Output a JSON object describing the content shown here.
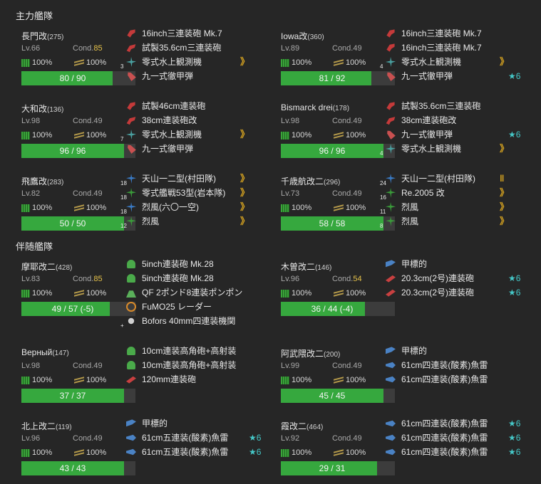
{
  "sections": {
    "main_fleet": "主力艦隊",
    "escort_fleet": "伴随艦隊"
  },
  "ships": [
    {
      "name": "長門改",
      "id": "(275)",
      "lv": "Lv.66",
      "cond_label": "Cond.",
      "cond": "85",
      "cond_high": true,
      "fuel": "100%",
      "ammo": "100%",
      "hp_text": "80 / 90",
      "hp_frac": 0.889,
      "equips": [
        {
          "icon": "mainred",
          "name": "16inch三連装砲 Mk.7",
          "slot": "",
          "prof": "",
          "star": ""
        },
        {
          "icon": "mainred2",
          "name": "試製35.6cm三連装砲",
          "slot": "",
          "prof": "",
          "star": ""
        },
        {
          "icon": "seaplane",
          "name": "零式水上観測機",
          "slot": "3",
          "prof": "》",
          "star": ""
        },
        {
          "icon": "apshell",
          "name": "九一式徹甲弾",
          "slot": "",
          "prof": "",
          "star": ""
        }
      ]
    },
    {
      "name": "Iowa改",
      "id": "(360)",
      "lv": "Lv.89",
      "cond_label": "Cond.",
      "cond": "49",
      "cond_high": false,
      "fuel": "100%",
      "ammo": "100%",
      "hp_text": "81 / 92",
      "hp_frac": 0.88,
      "equips": [
        {
          "icon": "mainred",
          "name": "16inch三連装砲 Mk.7",
          "slot": "",
          "prof": "",
          "star": ""
        },
        {
          "icon": "mainred",
          "name": "16inch三連装砲 Mk.7",
          "slot": "",
          "prof": "",
          "star": ""
        },
        {
          "icon": "seaplane",
          "name": "零式水上観測機",
          "slot": "4",
          "prof": "》",
          "star": ""
        },
        {
          "icon": "apshell",
          "name": "九一式徹甲弾",
          "slot": "",
          "prof": "",
          "star": "★6"
        }
      ]
    },
    {
      "name": "大和改",
      "id": "(136)",
      "lv": "Lv.98",
      "cond_label": "Cond.",
      "cond": "49",
      "cond_high": false,
      "fuel": "100%",
      "ammo": "100%",
      "hp_text": "96 / 96",
      "hp_frac": 1.0,
      "equips": [
        {
          "icon": "mainred",
          "name": "試製46cm連装砲",
          "slot": "",
          "prof": "",
          "star": ""
        },
        {
          "icon": "mainred2",
          "name": "38cm連装砲改",
          "slot": "",
          "prof": "",
          "star": ""
        },
        {
          "icon": "seaplane",
          "name": "零式水上観測機",
          "slot": "7",
          "prof": "》",
          "star": ""
        },
        {
          "icon": "apshell",
          "name": "九一式徹甲弾",
          "slot": "",
          "prof": "",
          "star": ""
        }
      ]
    },
    {
      "name": "Bismarck drei",
      "id": "(178)",
      "lv": "Lv.98",
      "cond_label": "Cond.",
      "cond": "49",
      "cond_high": false,
      "fuel": "100%",
      "ammo": "100%",
      "hp_text": "96 / 96",
      "hp_frac": 1.0,
      "equips": [
        {
          "icon": "mainred",
          "name": "試製35.6cm三連装砲",
          "slot": "",
          "prof": "",
          "star": ""
        },
        {
          "icon": "mainred2",
          "name": "38cm連装砲改",
          "slot": "",
          "prof": "",
          "star": ""
        },
        {
          "icon": "apshell",
          "name": "九一式徹甲弾",
          "slot": "",
          "prof": "",
          "star": "★6"
        },
        {
          "icon": "seaplane",
          "name": "零式水上観測機",
          "slot": "4",
          "prof": "》",
          "star": ""
        }
      ]
    },
    {
      "name": "飛鷹改",
      "id": "(283)",
      "lv": "Lv.82",
      "cond_label": "Cond.",
      "cond": "49",
      "cond_high": false,
      "fuel": "100%",
      "ammo": "100%",
      "hp_text": "50 / 50",
      "hp_frac": 1.0,
      "equips": [
        {
          "icon": "torpbomber",
          "name": "天山一二型(村田隊)",
          "slot": "18",
          "prof": "》",
          "star": ""
        },
        {
          "icon": "fighter",
          "name": "零式艦戦53型(岩本隊)",
          "slot": "18",
          "prof": "》",
          "star": ""
        },
        {
          "icon": "torpbomber",
          "name": "烈風(六〇一空)",
          "slot": "18",
          "prof": "》",
          "star": ""
        },
        {
          "icon": "fighter",
          "name": "烈風",
          "slot": "12",
          "prof": "》",
          "star": ""
        }
      ]
    },
    {
      "name": "千歳航改二",
      "id": "(296)",
      "lv": "Lv.73",
      "cond_label": "Cond.",
      "cond": "49",
      "cond_high": false,
      "fuel": "100%",
      "ammo": "100%",
      "hp_text": "58 / 58",
      "hp_frac": 1.0,
      "equips": [
        {
          "icon": "torpbomber",
          "name": "天山一二型(村田隊)",
          "slot": "24",
          "prof": "‖",
          "star": ""
        },
        {
          "icon": "fighter",
          "name": "Re.2005 改",
          "slot": "16",
          "prof": "》",
          "star": ""
        },
        {
          "icon": "fighter",
          "name": "烈風",
          "slot": "11",
          "prof": "》",
          "star": ""
        },
        {
          "icon": "fighter",
          "name": "烈風",
          "slot": "8",
          "prof": "》",
          "star": ""
        }
      ]
    },
    {
      "name": "摩耶改二",
      "id": "(428)",
      "lv": "Lv.83",
      "cond_label": "Cond.",
      "cond": "85",
      "cond_high": true,
      "fuel": "100%",
      "ammo": "100%",
      "hp_text": "49 / 57 (-5)",
      "hp_frac": 0.86,
      "equips": [
        {
          "icon": "greengun",
          "name": "5inch連装砲 Mk.28",
          "slot": "",
          "prof": "",
          "star": ""
        },
        {
          "icon": "greengun",
          "name": "5inch連装砲 Mk.28",
          "slot": "",
          "prof": "",
          "star": ""
        },
        {
          "icon": "aagun",
          "name": "QF 2ポンド8連装ポンポン",
          "slot": "",
          "prof": "",
          "star": ""
        },
        {
          "icon": "radar",
          "name": "FuMO25 レーダー",
          "slot": "",
          "prof": "",
          "star": ""
        },
        {
          "icon": "aa",
          "name": "Bofors 40mm四連装機関",
          "slot": "+",
          "prof": "",
          "star": ""
        }
      ]
    },
    {
      "name": "木曽改二",
      "id": "(146)",
      "lv": "Lv.96",
      "cond_label": "Cond.",
      "cond": "54",
      "cond_high": true,
      "fuel": "100%",
      "ammo": "100%",
      "hp_text": "36 / 44 (-4)",
      "hp_frac": 0.818,
      "equips": [
        {
          "icon": "flag",
          "name": "甲標的",
          "slot": "",
          "prof": "",
          "star": ""
        },
        {
          "icon": "secondary",
          "name": "20.3cm(2号)連装砲",
          "slot": "",
          "prof": "",
          "star": "★6"
        },
        {
          "icon": "secondary",
          "name": "20.3cm(2号)連装砲",
          "slot": "",
          "prof": "",
          "star": "★6"
        }
      ]
    },
    {
      "name": "Верный",
      "id": "(147)",
      "lv": "Lv.98",
      "cond_label": "Cond.",
      "cond": "49",
      "cond_high": false,
      "fuel": "100%",
      "ammo": "100%",
      "hp_text": "37 / 37",
      "hp_frac": 1.0,
      "equips": [
        {
          "icon": "greengun",
          "name": "10cm連装高角砲+高射装",
          "slot": "",
          "prof": "",
          "star": ""
        },
        {
          "icon": "greengun",
          "name": "10cm連装高角砲+高射装",
          "slot": "",
          "prof": "",
          "star": ""
        },
        {
          "icon": "secondary",
          "name": "120mm連装砲",
          "slot": "",
          "prof": "",
          "star": ""
        }
      ]
    },
    {
      "name": "阿武隈改二",
      "id": "(200)",
      "lv": "Lv.99",
      "cond_label": "Cond.",
      "cond": "49",
      "cond_high": false,
      "fuel": "100%",
      "ammo": "100%",
      "hp_text": "45 / 45",
      "hp_frac": 1.0,
      "equips": [
        {
          "icon": "flag",
          "name": "甲標的",
          "slot": "",
          "prof": "",
          "star": ""
        },
        {
          "icon": "torpedo",
          "name": "61cm四連装(酸素)魚雷",
          "slot": "",
          "prof": "",
          "star": ""
        },
        {
          "icon": "torpedo",
          "name": "61cm四連装(酸素)魚雷",
          "slot": "",
          "prof": "",
          "star": ""
        }
      ]
    },
    {
      "name": "北上改二",
      "id": "(119)",
      "lv": "Lv.96",
      "cond_label": "Cond.",
      "cond": "49",
      "cond_high": false,
      "fuel": "100%",
      "ammo": "100%",
      "hp_text": "43 / 43",
      "hp_frac": 1.0,
      "equips": [
        {
          "icon": "flag",
          "name": "甲標的",
          "slot": "",
          "prof": "",
          "star": ""
        },
        {
          "icon": "torpedo",
          "name": "61cm五連装(酸素)魚雷",
          "slot": "",
          "prof": "",
          "star": "★6"
        },
        {
          "icon": "torpedo",
          "name": "61cm五連装(酸素)魚雷",
          "slot": "",
          "prof": "",
          "star": "★6"
        }
      ]
    },
    {
      "name": "霞改二",
      "id": "(464)",
      "lv": "Lv.92",
      "cond_label": "Cond.",
      "cond": "49",
      "cond_high": false,
      "fuel": "100%",
      "ammo": "100%",
      "hp_text": "29 / 31",
      "hp_frac": 0.935,
      "equips": [
        {
          "icon": "torpedo",
          "name": "61cm四連装(酸素)魚雷",
          "slot": "",
          "prof": "",
          "star": "★6"
        },
        {
          "icon": "torpedo",
          "name": "61cm四連装(酸素)魚雷",
          "slot": "",
          "prof": "",
          "star": "★6"
        },
        {
          "icon": "torpedo",
          "name": "61cm四連装(酸素)魚雷",
          "slot": "",
          "prof": "",
          "star": "★6"
        }
      ]
    }
  ]
}
